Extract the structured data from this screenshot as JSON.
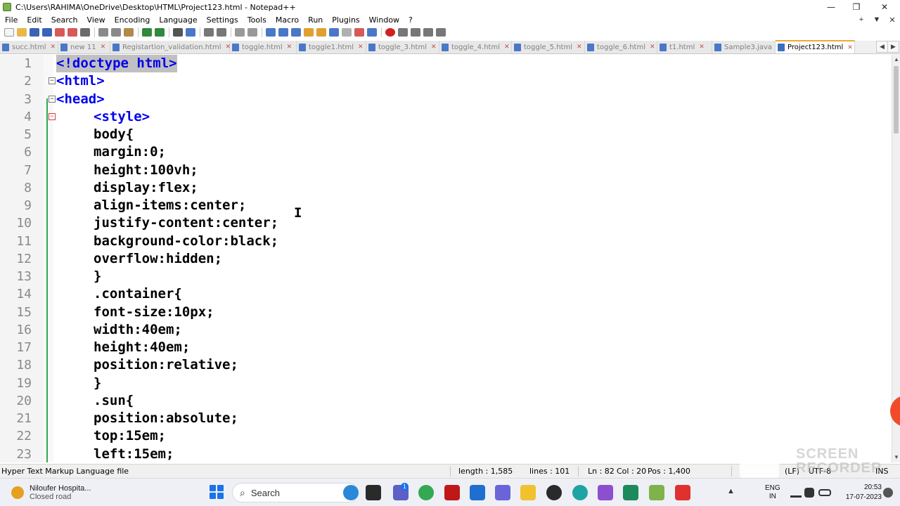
{
  "window": {
    "title": "C:\\Users\\RAHIMA\\OneDrive\\Desktop\\HTML\\Project123.html - Notepad++",
    "controls": {
      "minimize": "—",
      "maximize": "❐",
      "close": "✕"
    }
  },
  "menu": {
    "items": [
      "File",
      "Edit",
      "Search",
      "View",
      "Encoding",
      "Language",
      "Settings",
      "Tools",
      "Macro",
      "Run",
      "Plugins",
      "Window",
      "?"
    ],
    "right": [
      "+",
      "▼",
      "✕"
    ]
  },
  "tabs": [
    {
      "label": "succ.html",
      "close": "✕"
    },
    {
      "label": "new 11",
      "close": "✕"
    },
    {
      "label": "Registartion_validation.html",
      "close": "✕"
    },
    {
      "label": "toggle.html",
      "close": "✕"
    },
    {
      "label": "toggle1.html",
      "close": "✕"
    },
    {
      "label": "toggle_3.html",
      "close": "✕"
    },
    {
      "label": "toggle_4.html",
      "close": "✕"
    },
    {
      "label": "toggle_5.html",
      "close": "✕"
    },
    {
      "label": "toggle_6.html",
      "close": "✕"
    },
    {
      "label": "t1.html",
      "close": "✕"
    },
    {
      "label": "Sample3.java",
      "close": "✕"
    },
    {
      "label": "Project123.html",
      "close": "✕",
      "active": true
    }
  ],
  "tab_nav": {
    "left": "◀",
    "right": "▶",
    "close": "✕"
  },
  "editor": {
    "lines": [
      {
        "n": "1",
        "text": "<!doctype html>",
        "kind": "tag-sel"
      },
      {
        "n": "2",
        "text": "<html>",
        "kind": "tag",
        "fold": "−"
      },
      {
        "n": "3",
        "text": "<head>",
        "kind": "tag",
        "fold": "−"
      },
      {
        "n": "4",
        "text": "<style>",
        "kind": "tag",
        "fold": "−",
        "foldRed": true
      },
      {
        "n": "5",
        "text": "body{",
        "kind": "plain"
      },
      {
        "n": "6",
        "text": "margin:0;",
        "kind": "plain"
      },
      {
        "n": "7",
        "text": "height:100vh;",
        "kind": "plain"
      },
      {
        "n": "8",
        "text": "display:flex;",
        "kind": "plain"
      },
      {
        "n": "9",
        "text": "align-items:center;",
        "kind": "plain"
      },
      {
        "n": "10",
        "text": "justify-content:center;",
        "kind": "plain"
      },
      {
        "n": "11",
        "text": "background-color:black;",
        "kind": "plain"
      },
      {
        "n": "12",
        "text": "overflow:hidden;",
        "kind": "plain"
      },
      {
        "n": "13",
        "text": "}",
        "kind": "plain"
      },
      {
        "n": "14",
        "text": ".container{",
        "kind": "plain"
      },
      {
        "n": "15",
        "text": "font-size:10px;",
        "kind": "plain"
      },
      {
        "n": "16",
        "text": "width:40em;",
        "kind": "plain"
      },
      {
        "n": "17",
        "text": "height:40em;",
        "kind": "plain"
      },
      {
        "n": "18",
        "text": "position:relative;",
        "kind": "plain"
      },
      {
        "n": "19",
        "text": "}",
        "kind": "plain"
      },
      {
        "n": "20",
        "text": ".sun{",
        "kind": "plain"
      },
      {
        "n": "21",
        "text": "position:absolute;",
        "kind": "plain"
      },
      {
        "n": "22",
        "text": "top:15em;",
        "kind": "plain"
      },
      {
        "n": "23",
        "text": "left:15em;",
        "kind": "plain"
      }
    ]
  },
  "statusbar": {
    "filetype": "Hyper Text Markup Language file",
    "length": "length : 1,585",
    "lines": "lines : 101",
    "ln": "Ln : 82",
    "col": "Col : 20",
    "pos": "Pos : 1,400",
    "eol": "(LF)",
    "encoding": "UTF-8",
    "mode": "INS"
  },
  "taskbar": {
    "widget_title": "Niloufer Hospita...",
    "widget_sub": "Closed road",
    "search": "Search",
    "lang_top": "ENG",
    "lang_bottom": "IN",
    "time": "20:53",
    "date": "17-07-2023",
    "badge": "1"
  },
  "watermark": "SCREEN RECORDER",
  "colors": {
    "tag": "#0000ee",
    "fold_line": "#2fa84f",
    "active_tab_accent": "#f5a732"
  }
}
